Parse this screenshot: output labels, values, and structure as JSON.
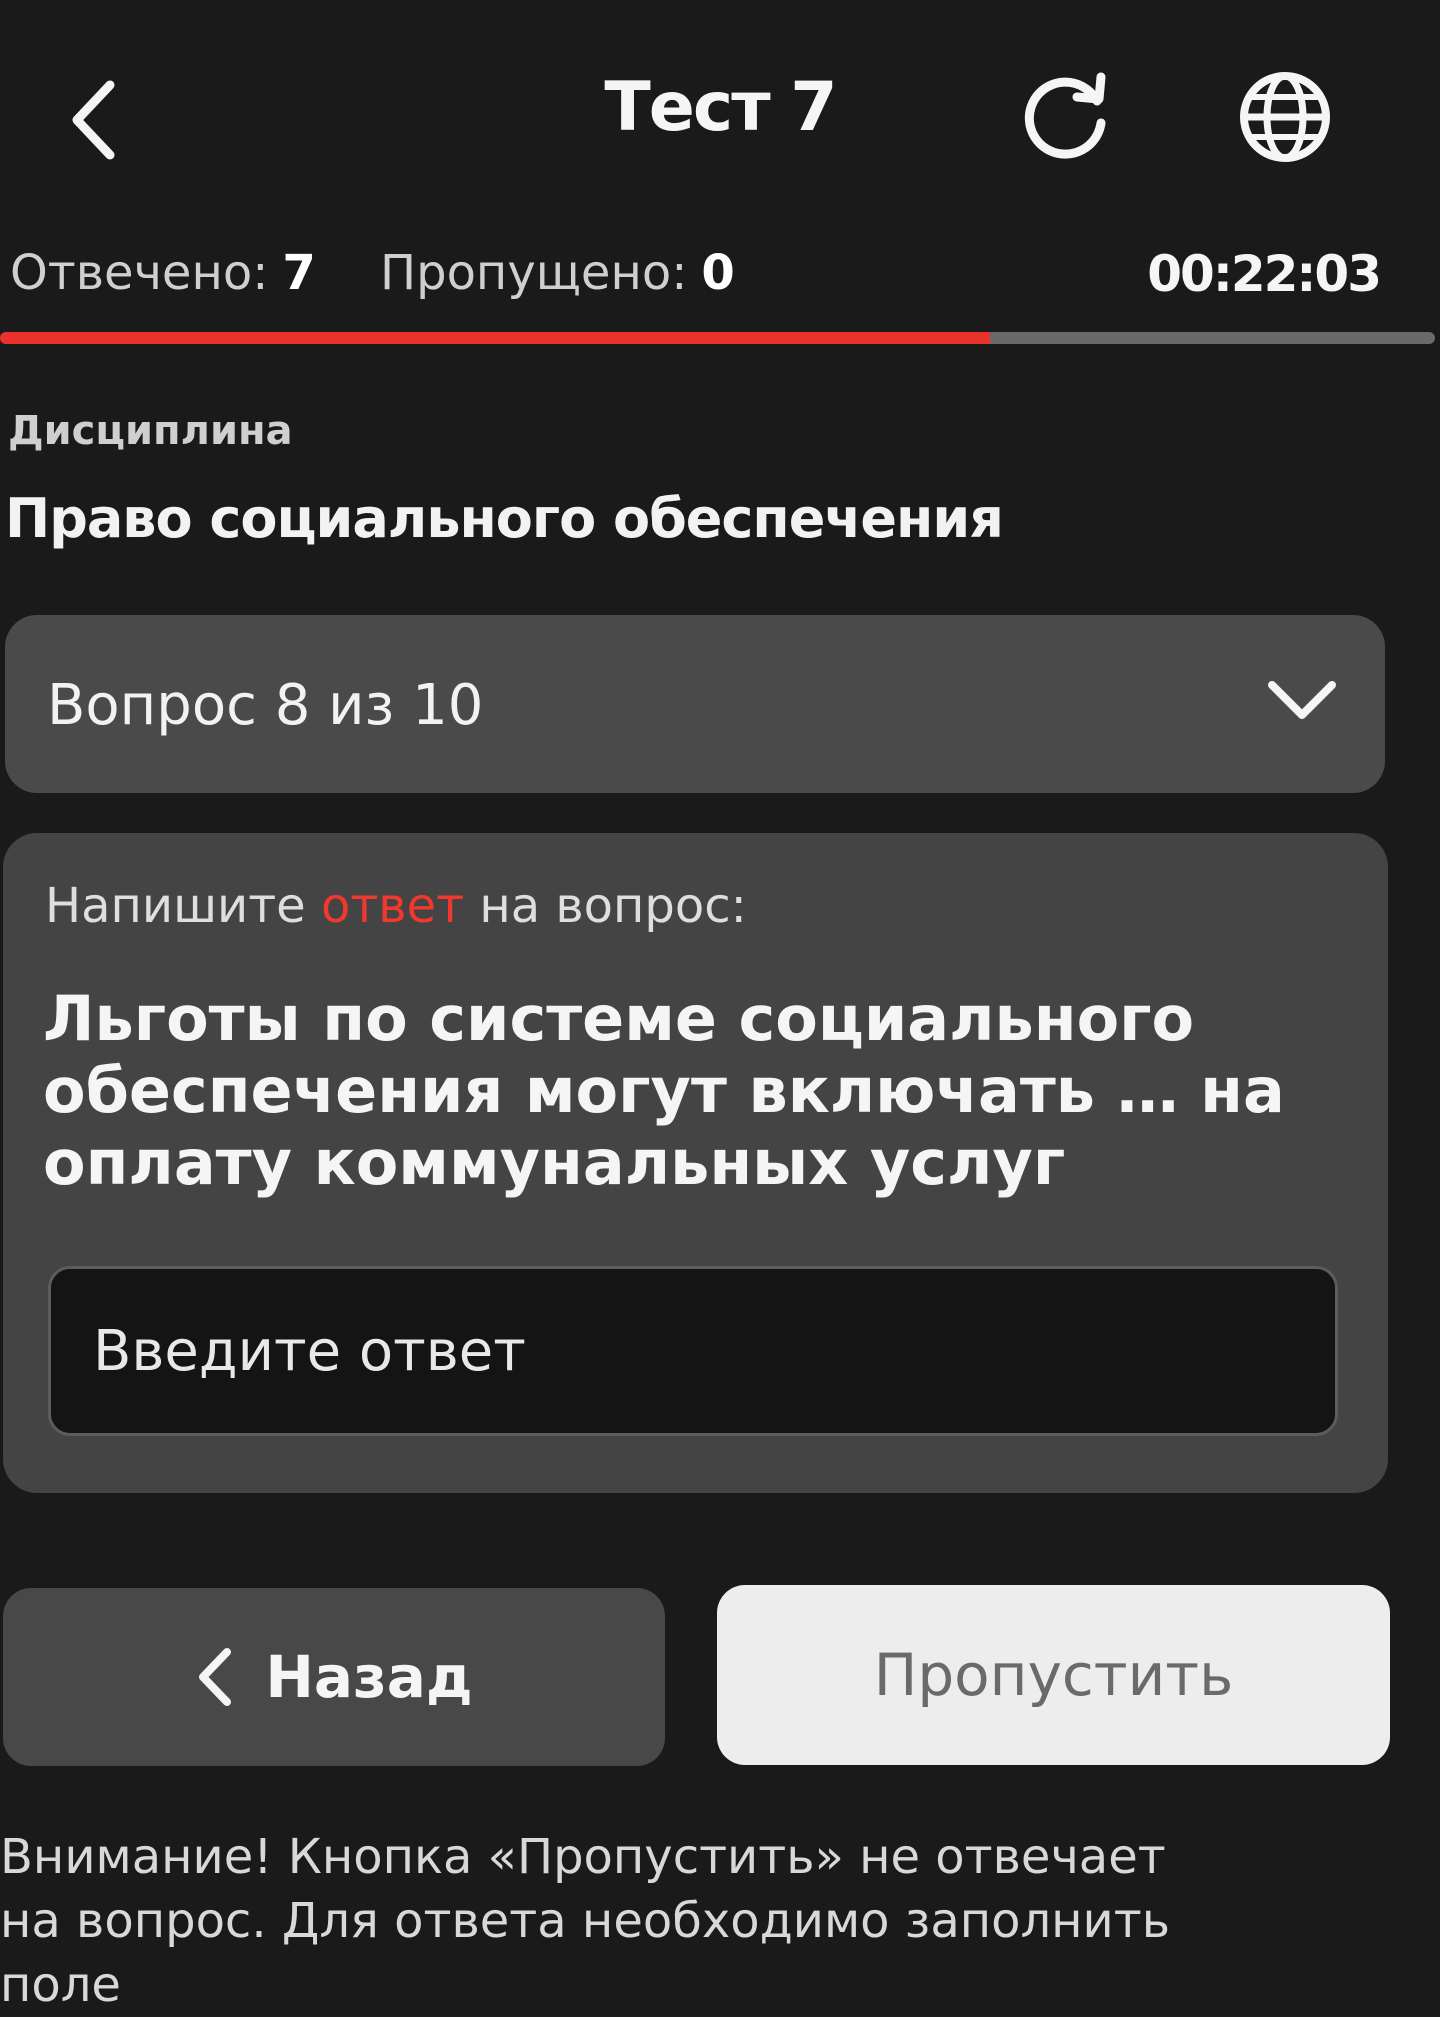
{
  "header": {
    "title": "Тест 7"
  },
  "stats": {
    "answered_label": "Отвечено:",
    "answered_value": "7",
    "skipped_label": "Пропущено:",
    "skipped_value": "0",
    "timer": "00:22:03"
  },
  "progress": {
    "fraction": 0.69,
    "fill_color": "#e8322a",
    "track_color": "#6a6a6a"
  },
  "discipline": {
    "label": "Дисциплина",
    "value": "Право социального обеспечения"
  },
  "question_select": {
    "label": "Вопрос 8 из 10"
  },
  "question": {
    "prompt_before": "Напишите ",
    "prompt_highlight": "ответ",
    "prompt_after": " на вопрос:",
    "text": "Льготы по системе социального обеспечения могут включать … на оплату коммунальных услуг",
    "input_placeholder": "Введите ответ",
    "input_value": ""
  },
  "buttons": {
    "back_label": "Назад",
    "skip_label": "Пропустить"
  },
  "warning": {
    "text": "Внимание! Кнопка «Пропустить» не отвечает на вопрос. Для ответа необходимо заполнить поле"
  },
  "icons": {
    "back": "chevron-left-icon",
    "refresh": "refresh-icon",
    "language": "globe-icon",
    "dropdown": "chevron-down-icon",
    "back_button": "chevron-left-icon"
  },
  "colors": {
    "accent": "#e8322a",
    "background": "#1a1a1a"
  }
}
